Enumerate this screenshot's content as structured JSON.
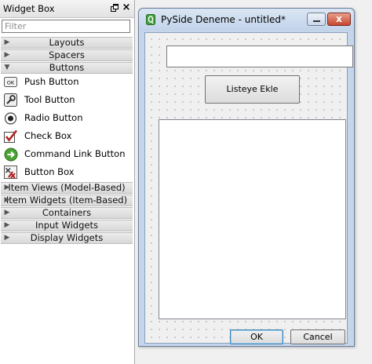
{
  "widget_box": {
    "title": "Widget Box",
    "float_icon": "float-icon",
    "close_label": "×",
    "filter_placeholder": "Filter",
    "categories": {
      "layouts": "Layouts",
      "spacers": "Spacers",
      "buttons": "Buttons",
      "item_views": "Item Views (Model-Based)",
      "item_widgets": "Item Widgets (Item-Based)",
      "containers": "Containers",
      "input_widgets": "Input Widgets",
      "display_widgets": "Display Widgets"
    },
    "button_items": [
      {
        "label": "Push Button",
        "icon": "push-button-icon",
        "icon_text": "OK"
      },
      {
        "label": "Tool Button",
        "icon": "tool-button-icon"
      },
      {
        "label": "Radio Button",
        "icon": "radio-button-icon"
      },
      {
        "label": "Check Box",
        "icon": "check-box-icon"
      },
      {
        "label": "Command Link Button",
        "icon": "command-link-icon"
      },
      {
        "label": "Button Box",
        "icon": "button-box-icon"
      }
    ]
  },
  "form_window": {
    "title": "PySide Deneme  - untitled*",
    "app_icon": "qt-designer-icon",
    "close_label": "x",
    "line_edit_value": "",
    "add_button_label": "Listeye Ekle",
    "ok_label": "OK",
    "cancel_label": "Cancel"
  },
  "colors": {
    "window_frame": "#c5d5ea",
    "close_button": "#c8452f",
    "qt_green": "#41a13a"
  }
}
